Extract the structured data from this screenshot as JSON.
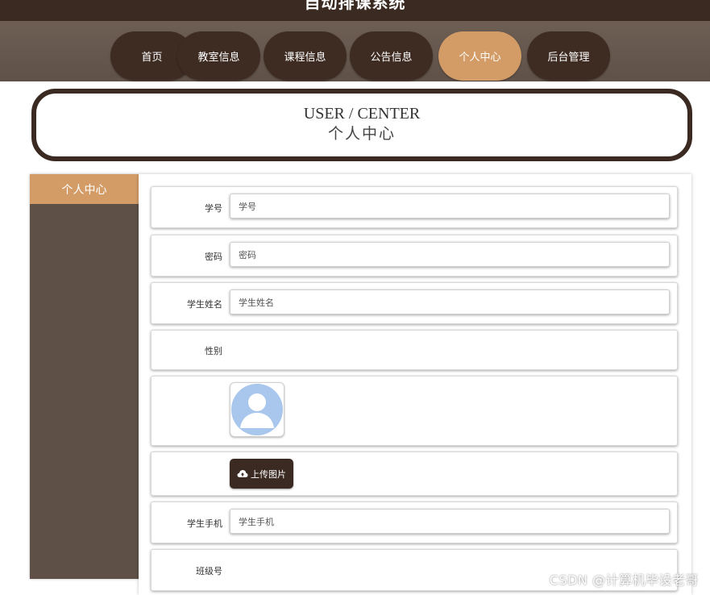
{
  "app": {
    "title": "自动排课系统"
  },
  "nav": {
    "items": [
      {
        "label": "首页"
      },
      {
        "label": "教室信息"
      },
      {
        "label": "课程信息"
      },
      {
        "label": "公告信息"
      },
      {
        "label": "个人中心",
        "active": true
      },
      {
        "label": "后台管理"
      }
    ]
  },
  "banner": {
    "title_en": "USER / CENTER",
    "title_cn": "个人中心"
  },
  "sidebar": {
    "heading": "个人中心"
  },
  "form": {
    "student_id": {
      "label": "学号",
      "placeholder": "学号"
    },
    "password": {
      "label": "密码",
      "placeholder": "密码"
    },
    "student_name": {
      "label": "学生姓名",
      "placeholder": "学生姓名"
    },
    "gender": {
      "label": "性别"
    },
    "avatar": {
      "icon": "user-avatar-placeholder"
    },
    "upload": {
      "label": "上传图片",
      "icon": "cloud-upload-icon"
    },
    "phone": {
      "label": "学生手机",
      "placeholder": "学生手机"
    },
    "class_no": {
      "label": "班级号"
    }
  },
  "watermark": "CSDN @计算机毕设老哥",
  "colors": {
    "dark_brown": "#3a2a22",
    "accent": "#d39c67",
    "nav_bg": "#6e5f55",
    "sidebar_bg": "#5e5047",
    "avatar_blue": "#a9c6ec"
  }
}
